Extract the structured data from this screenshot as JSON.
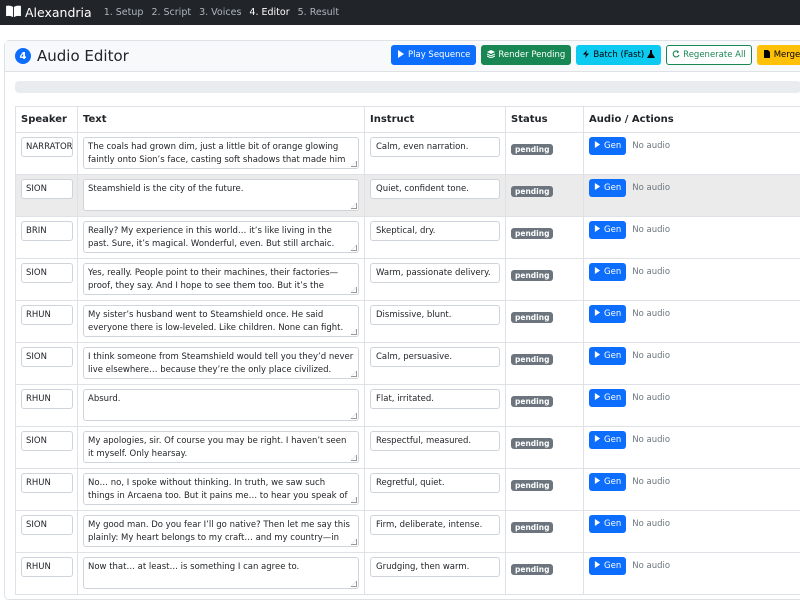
{
  "app": {
    "brand": "Alexandria",
    "steps": [
      "1. Setup",
      "2. Script",
      "3. Voices",
      "4. Editor",
      "5. Result"
    ],
    "active_step_index": 3
  },
  "editor": {
    "step_number": "4",
    "title": "Audio Editor",
    "buttons": {
      "play_sequence": "Play Sequence",
      "render_pending": "Render Pending",
      "batch_fast": "Batch (Fast)",
      "regenerate_all": "Regenerate All",
      "merge_all": "Merge All"
    },
    "progress_fraction": 0,
    "columns": [
      "Speaker",
      "Text",
      "Instruct",
      "Status",
      "Audio / Actions"
    ],
    "gen_label": "Gen",
    "no_audio_label": "No audio",
    "rows": [
      {
        "speaker": "NARRATOR",
        "text": "The coals had grown dim, just a little bit of orange glowing faintly onto Sion’s face, casting soft shadows that made him seem like a",
        "instruct": "Calm, even narration.",
        "status": "pending"
      },
      {
        "speaker": "SION",
        "text": "Steamshield is the city of the future.",
        "instruct": "Quiet, confident tone.",
        "status": "pending"
      },
      {
        "speaker": "BRIN",
        "text": "Really? My experience in this world… it’s like living in the past. Sure, it’s magical. Wonderful, even. But still archaic.",
        "instruct": "Skeptical, dry.",
        "status": "pending"
      },
      {
        "speaker": "SION",
        "text": "Yes, really. People point to their machines, their factories—proof, they say. And I hope to see them too. But it’s the mindset. In",
        "instruct": "Warm, passionate delivery.",
        "status": "pending"
      },
      {
        "speaker": "RHUN",
        "text": "My sister’s husband went to Steamshield once. He said everyone there is low-leveled. Like children. None can fight. None can make",
        "instruct": "Dismissive, blunt.",
        "status": "pending"
      },
      {
        "speaker": "SION",
        "text": "I think someone from Steamshield would tell you they’d never live elsewhere… because they’re the only place civilized. Water pipes",
        "instruct": "Calm, persuasive.",
        "status": "pending"
      },
      {
        "speaker": "RHUN",
        "text": "Absurd.",
        "instruct": "Flat, irritated.",
        "status": "pending"
      },
      {
        "speaker": "SION",
        "text": "My apologies, sir. Of course you may be right. I haven’t seen it myself. Only hearsay.",
        "instruct": "Respectful, measured.",
        "status": "pending"
      },
      {
        "speaker": "RHUN",
        "text": "No… no, I spoke without thinking. In truth, we saw such things in Arcaena too. But it pains me… to hear you speak of Frenaria so",
        "instruct": "Regretful, quiet.",
        "status": "pending"
      },
      {
        "speaker": "SION",
        "text": "My good man. Do you fear I’ll go native? Then let me say this plainly: My heart belongs to my craft… and my country—in that",
        "instruct": "Firm, deliberate, intense.",
        "status": "pending"
      },
      {
        "speaker": "RHUN",
        "text": "Now that… at least… is something I can agree to.",
        "instruct": "Grudging, then warm.",
        "status": "pending"
      }
    ],
    "highlighted_row_index": 1
  }
}
